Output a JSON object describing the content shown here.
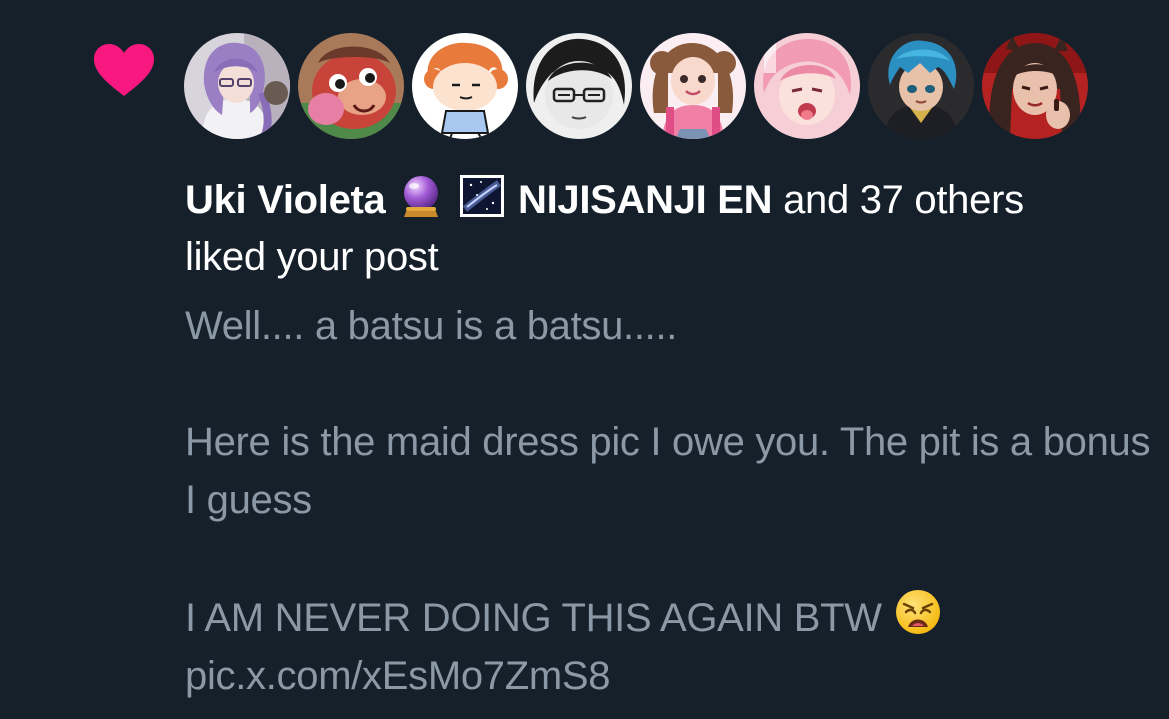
{
  "notification": {
    "type_icon": "heart-icon",
    "accent_color": "#f91880",
    "avatars": [
      {
        "label": "avatar-uki-violeta",
        "icon": "purple-haired-anime-portrait"
      },
      {
        "label": "avatar-red-creature",
        "icon": "red-cartoon-creature"
      },
      {
        "label": "avatar-orange-doodle",
        "icon": "orange-haired-doodle"
      },
      {
        "label": "avatar-glasses-sketch",
        "icon": "grayscale-glasses-sketch"
      },
      {
        "label": "avatar-pink-girl",
        "icon": "pink-brown-haired-girl"
      },
      {
        "label": "avatar-pink-anime",
        "icon": "pink-haired-anime-portrait"
      },
      {
        "label": "avatar-blue-haired",
        "icon": "blue-haired-anime-portrait"
      },
      {
        "label": "avatar-dark-haired",
        "icon": "dark-haired-red-background-portrait"
      }
    ],
    "liker_primary": "Uki Violeta",
    "liker_primary_emoji": "crystal-ball-icon",
    "liker_secondary_emoji": "milky-way-icon",
    "liker_secondary": "NIJISANJI EN",
    "others_text": " and 37 others",
    "action_text": "liked your post",
    "post": {
      "line1": "Well.... a batsu is a batsu.....",
      "line2": "Here is the maid dress pic I owe you. The pit is a bonus I guess",
      "line3": "I AM NEVER DOING THIS AGAIN BTW",
      "line3_emoji": "weary-face-icon",
      "link": "pic.x.com/xEsMo7ZmS8"
    },
    "background_color": "#15202b",
    "secondary_text_color": "#8b98a5"
  }
}
